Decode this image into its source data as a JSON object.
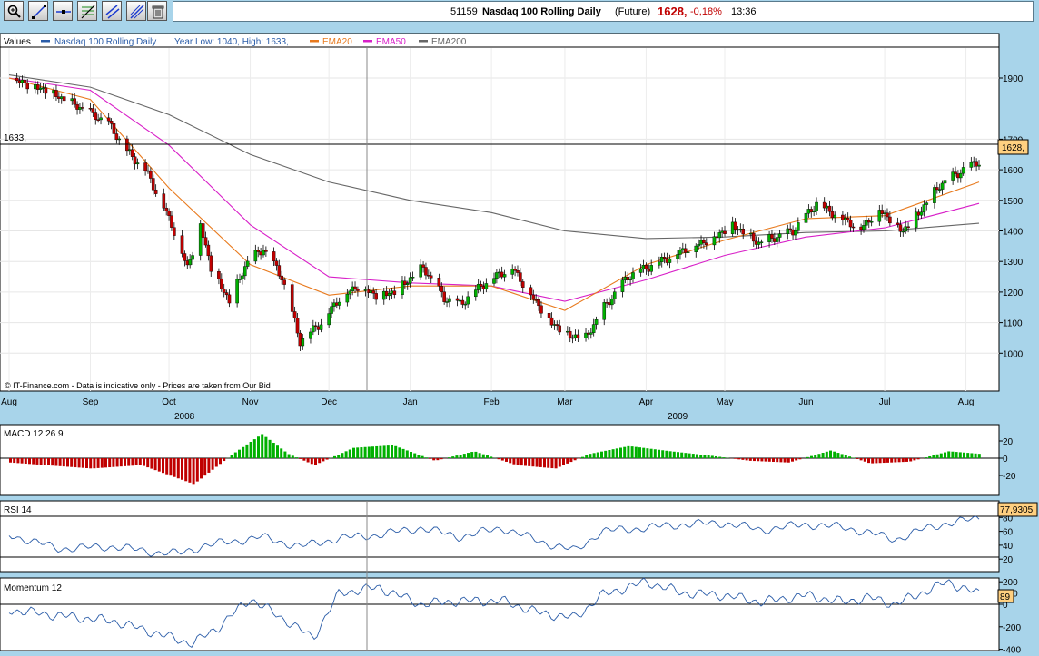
{
  "toolbar": {
    "buttons": [
      "zoom-icon",
      "draw-line-icon",
      "horizontal-line-icon",
      "fibonacci-icon",
      "trend-channel-icon",
      "parallel-lines-icon",
      "trash-icon"
    ]
  },
  "header": {
    "code": "51159",
    "name": "Nasdaq 100 Rolling Daily",
    "type": "(Future)",
    "price": "1628,",
    "change": "-0,18%",
    "time": "13:36"
  },
  "legend": {
    "values": "Values",
    "series": "Nasdaq 100 Rolling Daily",
    "range": "Year Low: 1040, High: 1633,",
    "ema20": "EMA20",
    "ema50": "EMA50",
    "ema200": "EMA200"
  },
  "price_panel": {
    "line_label": "1633,",
    "last_label": "1628,",
    "credit": "© IT-Finance.com - Data is indicative only - Prices are taken from Our Bid",
    "y_ticks": [
      "1900",
      "1700",
      "1600",
      "1500",
      "1400",
      "1300",
      "1200",
      "1100",
      "1000"
    ]
  },
  "x_axis": {
    "months": [
      "Aug",
      "Sep",
      "Oct",
      "Nov",
      "Dec",
      "Jan",
      "Feb",
      "Mar",
      "Apr",
      "May",
      "Jun",
      "Jul",
      "Aug"
    ],
    "years": [
      "2008",
      "2009"
    ]
  },
  "macd": {
    "title": "MACD 12 26 9",
    "ticks": [
      "20",
      "0",
      "-20"
    ]
  },
  "rsi": {
    "title": "RSI 14",
    "ticks": [
      "80",
      "60",
      "40",
      "20"
    ],
    "last": "77,9305"
  },
  "momentum": {
    "title": "Momentum 12",
    "ticks": [
      "200",
      "100",
      "0",
      "-200",
      "-400"
    ],
    "last": "89"
  },
  "colors": {
    "up": "#00b000",
    "down": "#c00000",
    "ema20": "#e87a1e",
    "ema50": "#d820c8",
    "ema200": "#666666",
    "bg": "#a8d4ea",
    "rsi_line": "#2a5ca8"
  },
  "chart_data": {
    "type": "candlestick",
    "title": "Nasdaq 100 Rolling Daily",
    "x_range": [
      "2008-08",
      "2009-08"
    ],
    "ylim": [
      980,
      1950
    ],
    "year_low": 1040,
    "year_high": 1633,
    "last": 1628,
    "close_series": [
      [
        "2008-08-01",
        1900
      ],
      [
        "2008-08-15",
        1860
      ],
      [
        "2008-08-31",
        1790
      ],
      [
        "2008-09-08",
        1750
      ],
      [
        "2008-09-15",
        1660
      ],
      [
        "2008-09-22",
        1600
      ],
      [
        "2008-09-29",
        1480
      ],
      [
        "2008-10-03",
        1400
      ],
      [
        "2008-10-08",
        1280
      ],
      [
        "2008-10-13",
        1420
      ],
      [
        "2008-10-17",
        1280
      ],
      [
        "2008-10-24",
        1170
      ],
      [
        "2008-10-31",
        1300
      ],
      [
        "2008-11-06",
        1340
      ],
      [
        "2008-11-13",
        1250
      ],
      [
        "2008-11-20",
        1040
      ],
      [
        "2008-11-28",
        1100
      ],
      [
        "2008-12-05",
        1180
      ],
      [
        "2008-12-12",
        1220
      ],
      [
        "2008-12-19",
        1190
      ],
      [
        "2008-12-26",
        1200
      ],
      [
        "2009-01-06",
        1280
      ],
      [
        "2009-01-14",
        1180
      ],
      [
        "2009-01-20",
        1160
      ],
      [
        "2009-01-28",
        1220
      ],
      [
        "2009-02-04",
        1260
      ],
      [
        "2009-02-09",
        1280
      ],
      [
        "2009-02-17",
        1180
      ],
      [
        "2009-02-24",
        1100
      ],
      [
        "2009-03-02",
        1060
      ],
      [
        "2009-03-09",
        1050
      ],
      [
        "2009-03-16",
        1150
      ],
      [
        "2009-03-25",
        1250
      ],
      [
        "2009-04-06",
        1300
      ],
      [
        "2009-04-16",
        1340
      ],
      [
        "2009-04-27",
        1380
      ],
      [
        "2009-05-04",
        1420
      ],
      [
        "2009-05-14",
        1360
      ],
      [
        "2009-05-27",
        1400
      ],
      [
        "2009-06-05",
        1490
      ],
      [
        "2009-06-15",
        1440
      ],
      [
        "2009-06-22",
        1410
      ],
      [
        "2009-06-29",
        1470
      ],
      [
        "2009-07-08",
        1400
      ],
      [
        "2009-07-15",
        1470
      ],
      [
        "2009-07-22",
        1550
      ],
      [
        "2009-07-31",
        1600
      ],
      [
        "2009-08-06",
        1628
      ]
    ],
    "ema20": [
      [
        "2008-08-01",
        1900
      ],
      [
        "2008-09-01",
        1830
      ],
      [
        "2008-10-01",
        1540
      ],
      [
        "2008-11-01",
        1290
      ],
      [
        "2008-12-01",
        1190
      ],
      [
        "2009-01-01",
        1220
      ],
      [
        "2009-02-01",
        1220
      ],
      [
        "2009-03-01",
        1140
      ],
      [
        "2009-04-01",
        1290
      ],
      [
        "2009-05-01",
        1370
      ],
      [
        "2009-06-01",
        1440
      ],
      [
        "2009-07-01",
        1450
      ],
      [
        "2009-08-06",
        1560
      ]
    ],
    "ema50": [
      [
        "2008-08-01",
        1900
      ],
      [
        "2008-09-01",
        1860
      ],
      [
        "2008-10-01",
        1680
      ],
      [
        "2008-11-01",
        1420
      ],
      [
        "2008-12-01",
        1250
      ],
      [
        "2009-01-01",
        1230
      ],
      [
        "2009-02-01",
        1220
      ],
      [
        "2009-03-01",
        1170
      ],
      [
        "2009-04-01",
        1240
      ],
      [
        "2009-05-01",
        1320
      ],
      [
        "2009-06-01",
        1380
      ],
      [
        "2009-07-01",
        1410
      ],
      [
        "2009-08-06",
        1490
      ]
    ],
    "ema200": [
      [
        "2008-08-01",
        1910
      ],
      [
        "2008-09-01",
        1870
      ],
      [
        "2008-10-01",
        1780
      ],
      [
        "2008-11-01",
        1650
      ],
      [
        "2008-12-01",
        1560
      ],
      [
        "2009-01-01",
        1500
      ],
      [
        "2009-02-01",
        1460
      ],
      [
        "2009-03-01",
        1400
      ],
      [
        "2009-04-01",
        1375
      ],
      [
        "2009-05-01",
        1380
      ],
      [
        "2009-06-01",
        1395
      ],
      [
        "2009-07-01",
        1400
      ],
      [
        "2009-08-06",
        1425
      ]
    ],
    "macd_envelope": [
      [
        "2008-08-01",
        -5
      ],
      [
        "2008-09-01",
        -12
      ],
      [
        "2008-09-20",
        -8
      ],
      [
        "2008-10-10",
        -30
      ],
      [
        "2008-10-25",
        5
      ],
      [
        "2008-11-05",
        28
      ],
      [
        "2008-11-15",
        5
      ],
      [
        "2008-11-25",
        -8
      ],
      [
        "2008-12-10",
        12
      ],
      [
        "2008-12-25",
        15
      ],
      [
        "2009-01-10",
        -3
      ],
      [
        "2009-01-25",
        8
      ],
      [
        "2009-02-10",
        -8
      ],
      [
        "2009-02-25",
        -12
      ],
      [
        "2009-03-10",
        5
      ],
      [
        "2009-03-25",
        14
      ],
      [
        "2009-04-10",
        8
      ],
      [
        "2009-04-25",
        3
      ],
      [
        "2009-05-10",
        -3
      ],
      [
        "2009-05-25",
        -5
      ],
      [
        "2009-06-10",
        9
      ],
      [
        "2009-06-25",
        -6
      ],
      [
        "2009-07-10",
        -4
      ],
      [
        "2009-07-25",
        8
      ],
      [
        "2009-08-06",
        5
      ]
    ],
    "rsi": [
      [
        "2008-08-01",
        55
      ],
      [
        "2008-08-20",
        35
      ],
      [
        "2008-09-10",
        38
      ],
      [
        "2008-09-25",
        30
      ],
      [
        "2008-10-05",
        28
      ],
      [
        "2008-10-15",
        40
      ],
      [
        "2008-10-25",
        45
      ],
      [
        "2008-11-05",
        52
      ],
      [
        "2008-11-20",
        38
      ],
      [
        "2008-12-05",
        50
      ],
      [
        "2008-12-20",
        55
      ],
      [
        "2009-01-05",
        65
      ],
      [
        "2009-01-20",
        52
      ],
      [
        "2009-02-05",
        65
      ],
      [
        "2009-02-20",
        45
      ],
      [
        "2009-03-05",
        32
      ],
      [
        "2009-03-15",
        60
      ],
      [
        "2009-04-01",
        65
      ],
      [
        "2009-04-15",
        70
      ],
      [
        "2009-05-01",
        72
      ],
      [
        "2009-05-15",
        62
      ],
      [
        "2009-06-01",
        70
      ],
      [
        "2009-06-15",
        66
      ],
      [
        "2009-06-25",
        58
      ],
      [
        "2009-07-05",
        48
      ],
      [
        "2009-07-15",
        62
      ],
      [
        "2009-07-25",
        72
      ],
      [
        "2009-08-06",
        78
      ]
    ],
    "momentum": [
      [
        "2008-08-01",
        -50
      ],
      [
        "2008-08-20",
        -100
      ],
      [
        "2008-09-10",
        -150
      ],
      [
        "2008-09-25",
        -250
      ],
      [
        "2008-10-10",
        -350
      ],
      [
        "2008-10-20",
        -200
      ],
      [
        "2008-11-01",
        50
      ],
      [
        "2008-11-15",
        -150
      ],
      [
        "2008-11-25",
        -300
      ],
      [
        "2008-12-05",
        100
      ],
      [
        "2008-12-20",
        150
      ],
      [
        "2009-01-05",
        0
      ],
      [
        "2009-01-20",
        30
      ],
      [
        "2009-02-05",
        30
      ],
      [
        "2009-02-20",
        -80
      ],
      [
        "2009-03-05",
        -120
      ],
      [
        "2009-03-15",
        80
      ],
      [
        "2009-04-01",
        200
      ],
      [
        "2009-04-15",
        100
      ],
      [
        "2009-05-01",
        80
      ],
      [
        "2009-05-15",
        20
      ],
      [
        "2009-06-01",
        80
      ],
      [
        "2009-06-15",
        20
      ],
      [
        "2009-06-25",
        60
      ],
      [
        "2009-07-05",
        0
      ],
      [
        "2009-07-15",
        100
      ],
      [
        "2009-07-25",
        200
      ],
      [
        "2009-08-06",
        89
      ]
    ]
  }
}
